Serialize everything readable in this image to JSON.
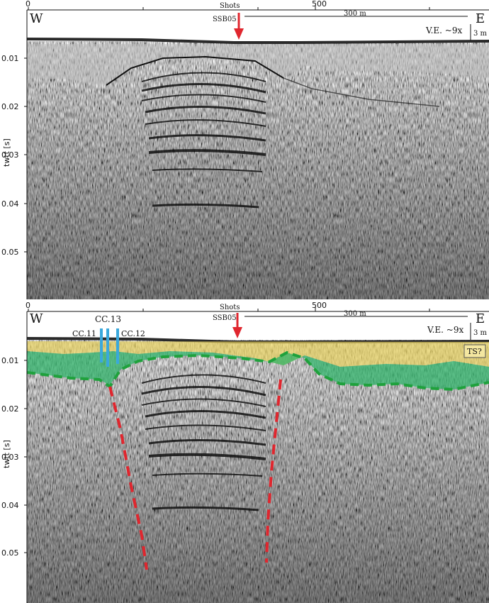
{
  "y_axis_label": "twtt [s]",
  "x_axis_name": "Shots",
  "x_ticks": [
    "0",
    "500"
  ],
  "y_ticks": [
    "0.01",
    "0.02",
    "0.03",
    "0.04",
    "0.05"
  ],
  "west_label": "W",
  "east_label": "E",
  "profile_marker": "SSB05",
  "scale_label": "300 m",
  "vertical_exaggeration": "V.E. ~9x",
  "vertical_scale": "3 m",
  "cores": [
    "CC.11",
    "CC.13",
    "CC.12"
  ],
  "unit_label": "TS?",
  "colors": {
    "arrow": "#e0262e",
    "core": "#3aa8dc",
    "yellow_unit": "#e8d15c",
    "green_unit": "#2fb36a",
    "green_boundary": "#1fa13c",
    "fault": "#e0262e"
  }
}
